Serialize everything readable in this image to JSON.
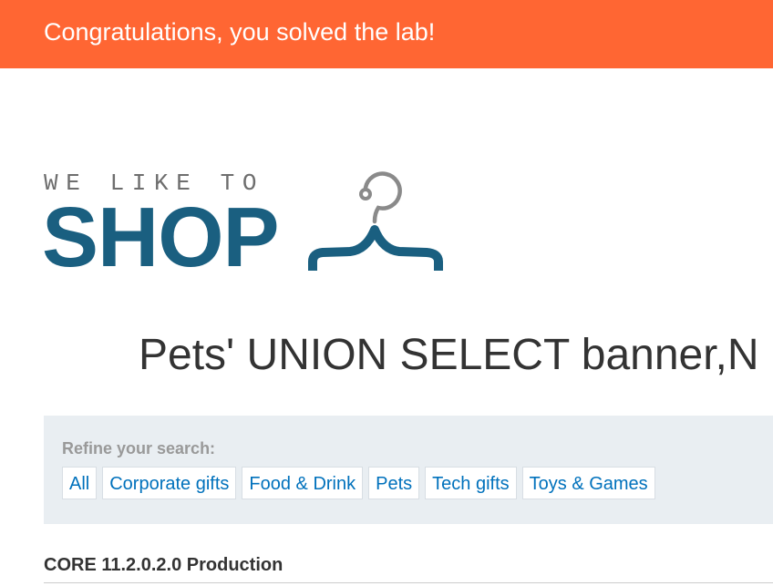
{
  "banner": {
    "message": "Congratulations, you solved the lab!",
    "color": "#ff6633"
  },
  "logo": {
    "tagline": "WE LIKE TO",
    "word": "SHOP",
    "icon": "hanger-icon",
    "brand_color": "#1a5f80"
  },
  "search": {
    "heading": "Pets' UNION SELECT banner,N"
  },
  "refine": {
    "label": "Refine your search:",
    "filters": [
      "All",
      "Corporate gifts",
      "Food & Drink",
      "Pets",
      "Tech gifts",
      "Toys & Games"
    ],
    "link_color": "#0071bc"
  },
  "results": {
    "first_row": "CORE 11.2.0.2.0 Production"
  }
}
